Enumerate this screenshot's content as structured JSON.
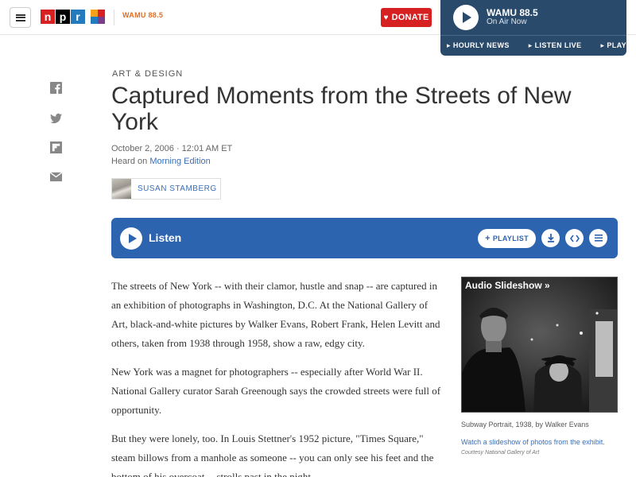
{
  "header": {
    "menu_icon": "hamburger-icon",
    "logo_letters": [
      "n",
      "p",
      "r"
    ],
    "station_logo": "WAMU 88.5",
    "donate_label": "DONATE"
  },
  "station_player": {
    "name": "WAMU 88.5",
    "status": "On Air Now",
    "links": [
      "HOURLY NEWS",
      "LISTEN LIVE",
      "PLAYLIST"
    ]
  },
  "share_icons": [
    "facebook-icon",
    "twitter-icon",
    "flipboard-icon",
    "email-icon"
  ],
  "article": {
    "section": "ART & DESIGN",
    "title": "Captured Moments from the Streets of New York",
    "date": "October 2, 2006 · 12:01 AM ET",
    "heard_prefix": "Heard on",
    "program": "Morning Edition",
    "author": "SUSAN STAMBERG"
  },
  "audio": {
    "listen_label": "Listen",
    "playlist_label": "PLAYLIST",
    "playlist_prefix": "+"
  },
  "body": {
    "paragraphs": [
      "The streets of New York -- with their clamor, hustle and snap -- are captured in an exhibition of photographs in Washington, D.C. At the National Gallery of Art, black-and-white pictures by Walker Evans, Robert Frank, Helen Levitt and others, taken from 1938 through 1958, show a raw, edgy city.",
      "New York was a magnet for photographers -- especially after World War II. National Gallery curator Sarah Greenough says the crowded streets were full of opportunity.",
      "But they were lonely, too. In Louis Stettner's 1952 picture, \"Times Square,\" steam billows from a manhole as someone -- you can only see his feet and the bottom of his overcoat -- strolls past in the night."
    ]
  },
  "sidebar": {
    "slideshow_title": "Audio Slideshow »",
    "caption": "Subway Portrait, 1938, by Walker Evans",
    "link": "Watch a slideshow of photos from the exhibit.",
    "credit": "Courtesy National Gallery of Art"
  }
}
